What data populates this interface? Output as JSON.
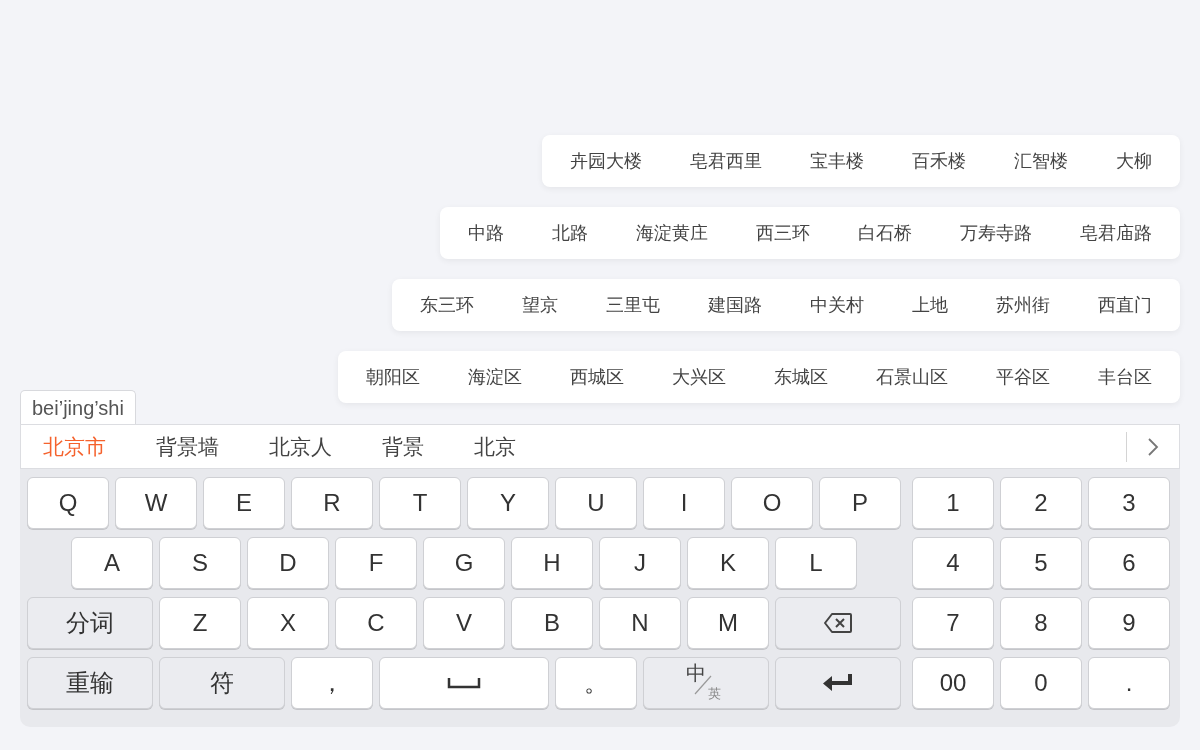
{
  "suggestion_rows": [
    {
      "items": [
        "卉园大楼",
        "皂君西里",
        "宝丰楼",
        "百禾楼",
        "汇智楼",
        "大柳"
      ]
    },
    {
      "items": [
        "中路",
        "北路",
        "海淀黄庄",
        "西三环",
        "白石桥",
        "万寿寺路",
        "皂君庙路"
      ]
    },
    {
      "items": [
        "东三环",
        "望京",
        "三里屯",
        "建国路",
        "中关村",
        "上地",
        "苏州街",
        "西直门"
      ]
    },
    {
      "items": [
        "朝阳区",
        "海淀区",
        "西城区",
        "大兴区",
        "东城区",
        "石景山区",
        "平谷区",
        "丰台区"
      ]
    }
  ],
  "composition": "bei’jing’shi",
  "candidates": [
    {
      "text": "北京市",
      "selected": true
    },
    {
      "text": "背景墙",
      "selected": false
    },
    {
      "text": "北京人",
      "selected": false
    },
    {
      "text": "背景",
      "selected": false
    },
    {
      "text": "北京",
      "selected": false
    }
  ],
  "letter_rows": [
    [
      {
        "kind": "letter",
        "label": "Q"
      },
      {
        "kind": "letter",
        "label": "W"
      },
      {
        "kind": "letter",
        "label": "E"
      },
      {
        "kind": "letter",
        "label": "R"
      },
      {
        "kind": "letter",
        "label": "T"
      },
      {
        "kind": "letter",
        "label": "Y"
      },
      {
        "kind": "letter",
        "label": "U"
      },
      {
        "kind": "letter",
        "label": "I"
      },
      {
        "kind": "letter",
        "label": "O"
      },
      {
        "kind": "letter",
        "label": "P"
      }
    ],
    [
      {
        "kind": "letter",
        "label": "A"
      },
      {
        "kind": "letter",
        "label": "S"
      },
      {
        "kind": "letter",
        "label": "D"
      },
      {
        "kind": "letter",
        "label": "F"
      },
      {
        "kind": "letter",
        "label": "G"
      },
      {
        "kind": "letter",
        "label": "H"
      },
      {
        "kind": "letter",
        "label": "J"
      },
      {
        "kind": "letter",
        "label": "K"
      },
      {
        "kind": "letter",
        "label": "L"
      }
    ],
    [
      {
        "kind": "function",
        "label": "分词"
      },
      {
        "kind": "letter",
        "label": "Z"
      },
      {
        "kind": "letter",
        "label": "X"
      },
      {
        "kind": "letter",
        "label": "C"
      },
      {
        "kind": "letter",
        "label": "V"
      },
      {
        "kind": "letter",
        "label": "B"
      },
      {
        "kind": "letter",
        "label": "N"
      },
      {
        "kind": "letter",
        "label": "M"
      },
      {
        "kind": "backspace"
      }
    ],
    [
      {
        "kind": "function",
        "label": "重输"
      },
      {
        "kind": "function",
        "label": "符"
      },
      {
        "kind": "letter",
        "label": "，"
      },
      {
        "kind": "space"
      },
      {
        "kind": "letter",
        "label": "。"
      },
      {
        "kind": "lang",
        "label": "中",
        "sub": "英"
      },
      {
        "kind": "enter"
      }
    ]
  ],
  "numpad_rows": [
    [
      "1",
      "2",
      "3"
    ],
    [
      "4",
      "5",
      "6"
    ],
    [
      "7",
      "8",
      "9"
    ],
    [
      "00",
      "0",
      "."
    ]
  ]
}
